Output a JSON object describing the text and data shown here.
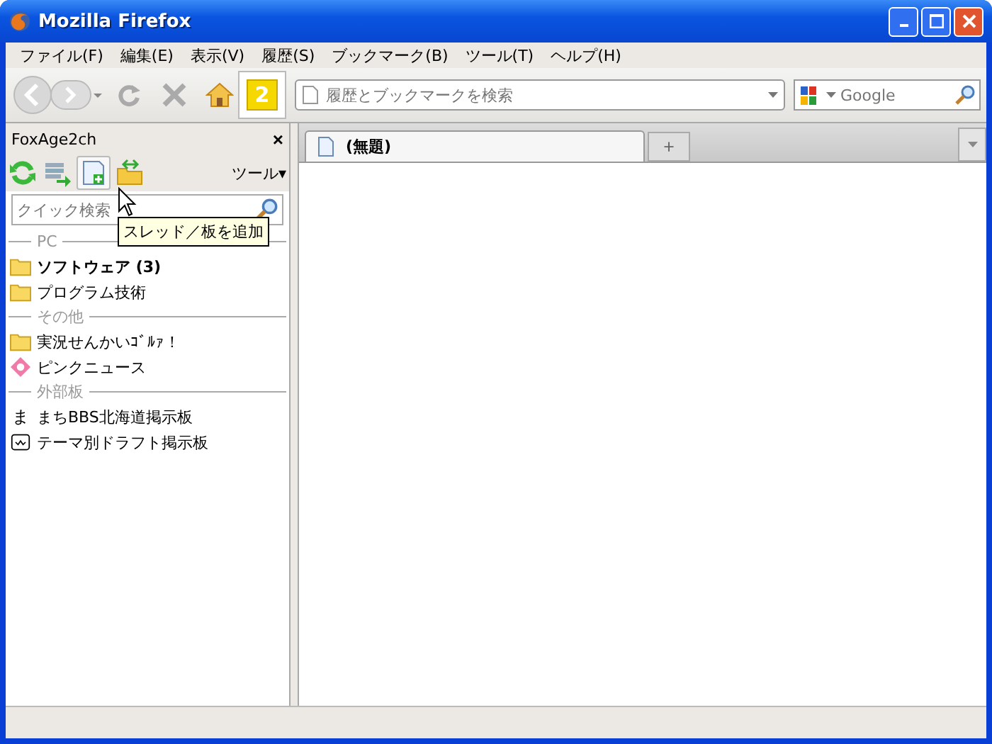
{
  "window": {
    "title": "Mozilla Firefox"
  },
  "menu": [
    "ファイル(F)",
    "編集(E)",
    "表示(V)",
    "履歴(S)",
    "ブックマーク(B)",
    "ツール(T)",
    "ヘルプ(H)"
  ],
  "toolbar": {
    "badge": "2",
    "url_placeholder": "履歴とブックマークを検索",
    "search_placeholder": "Google"
  },
  "sidebar": {
    "title": "FoxAge2ch",
    "close": "×",
    "tools_menu": "ツール▾",
    "search_placeholder": "クイック検索",
    "tooltip": "スレッド／板を追加",
    "groups": [
      {
        "label": "PC",
        "items": [
          {
            "kind": "folder",
            "label": "ソフトウェア (3)",
            "unread": true
          },
          {
            "kind": "folder",
            "label": "プログラム技術",
            "unread": false
          }
        ]
      },
      {
        "label": "その他",
        "items": [
          {
            "kind": "folder",
            "label": "実況せんかいｺﾞﾙｧ！",
            "unread": false
          },
          {
            "kind": "pink",
            "label": "ピンクニュース",
            "unread": false
          }
        ]
      },
      {
        "label": "外部板",
        "items": [
          {
            "kind": "char",
            "icon": "ま",
            "label": "まちBBS北海道掲示板",
            "unread": false
          },
          {
            "kind": "face",
            "label": "テーマ別ドラフト掲示板",
            "unread": false
          }
        ]
      }
    ]
  },
  "tabs": [
    {
      "label": "(無題)",
      "selected": true
    }
  ],
  "new_tab": "+"
}
